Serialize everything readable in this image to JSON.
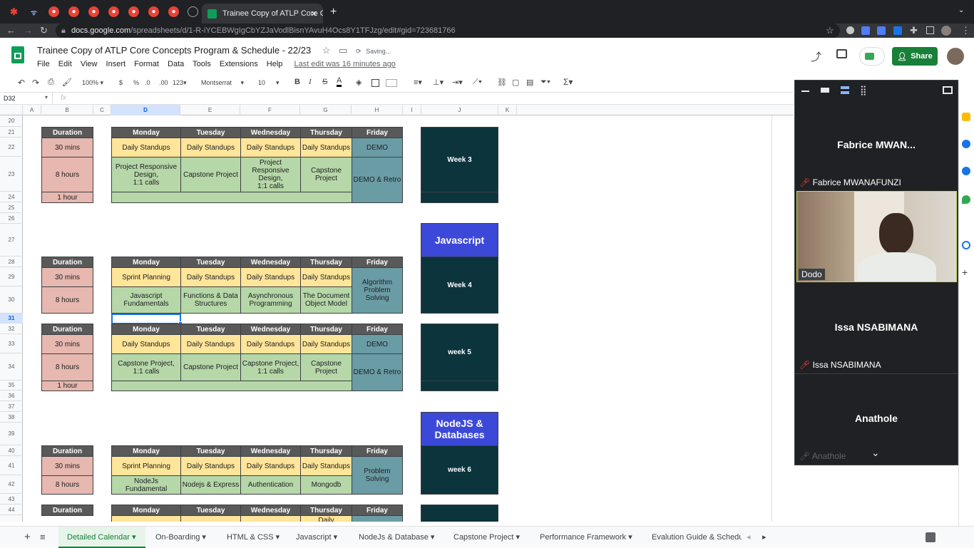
{
  "browser": {
    "active_tab_title": "Trainee Copy of ATLP Core Co",
    "url_host": "docs.google.com",
    "url_path": "/spreadsheets/d/1-R-iYCEBWgIgCbYZJaVodlBisnYAvuH4Ocs8Y1TFJzg/edit#gid=723681766"
  },
  "doc": {
    "title": "Trainee Copy of ATLP Core Concepts Program & Schedule - 22/23",
    "status": "Saving...",
    "menus": [
      "File",
      "Edit",
      "View",
      "Insert",
      "Format",
      "Data",
      "Tools",
      "Extensions",
      "Help"
    ],
    "last_edit": "Last edit was 16 minutes ago",
    "share_label": "Share"
  },
  "toolbar": {
    "zoom": "100%",
    "currency": "$",
    "percent": "%",
    "dec_dec": ".0",
    "dec_inc": ".00",
    "format_more": "123",
    "font": "Montserrat",
    "font_size": "10",
    "bold": "B",
    "italic": "I",
    "strike": "S",
    "text_color": "A"
  },
  "name_box": "D32",
  "fx": "fx",
  "columns": [
    "A",
    "B",
    "C",
    "D",
    "E",
    "F",
    "G",
    "H",
    "I",
    "J",
    "K"
  ],
  "rows": [
    "20",
    "21",
    "22",
    "23",
    "24",
    "25",
    "26",
    "27",
    "28",
    "29",
    "30",
    "31",
    "32",
    "33",
    "34",
    "35",
    "36",
    "37",
    "38",
    "39",
    "40",
    "41",
    "42",
    "43",
    "44",
    "45"
  ],
  "schedule": {
    "duration_header": "Duration",
    "days": [
      "Monday",
      "Tuesday",
      "Wednesday",
      "Thursday",
      "Friday"
    ],
    "d30": "30 mins",
    "d8": "8 hours",
    "d1": "1 hour",
    "w3": {
      "label": "Week 3",
      "mon1": "Daily Standups",
      "tue1": "Daily Standups",
      "wed1": "Daily Standups",
      "thu1": "Daily Standups",
      "fri1": "DEMO",
      "mon2": "Project Responsive Design,\n1:1 calls",
      "tue2": "Capstone Project",
      "wed2": "Project Responsive Design,\n1:1 calls",
      "thu2": "Capstone Project",
      "fri2": "DEMO & Retro"
    },
    "js": {
      "section": "Javascript",
      "label": "Week 4",
      "mon1": "Sprint Planning",
      "tue1": "Daily Standups",
      "wed1": "Daily Standups",
      "thu1": "Daily Standups",
      "fri": "Algorithm Problem Solving",
      "mon2": "Javascript Fundamentals",
      "tue2": "Functions & Data Structures",
      "wed2": "Asynchronous Programming",
      "thu2": "The Document Object Model"
    },
    "w5": {
      "label": "week 5",
      "mon1": "Daily Standups",
      "tue1": "Daily Standups",
      "wed1": "Daily Standups",
      "thu1": "Daily Standups",
      "fri1": "DEMO",
      "mon2": "Capstone Project,\n1:1 calls",
      "tue2": "Capstone Project",
      "wed2": "Capstone Project,\n1:1 calls",
      "thu2": "Capstone Project",
      "fri2": "DEMO & Retro"
    },
    "node": {
      "section": "NodeJS & Databases",
      "label": "week 6",
      "mon1": "Sprint Planning",
      "tue1": "Daily Standups",
      "wed1": "Daily Standups",
      "thu1": "Daily Standups",
      "fri": "Problem Solving",
      "mon2": "NodeJs Fundamental",
      "tue2": "Nodejs & Express",
      "wed2": "Authentication",
      "thu2": "Mongodb"
    },
    "last_thu": "Daily"
  },
  "sheet_tabs": [
    "Detailed Calendar",
    "On-Boarding",
    "HTML & CSS",
    "Javascript",
    "NodeJs & Database",
    "Capstone Project",
    "Performance Framework",
    "Evalution Guide & Schedu"
  ],
  "meet": {
    "p1_name": "Fabrice  MWAN...",
    "p1_label": "Fabrice MWANAFUNZI",
    "video_label": "Dodo",
    "p2_name": "Issa NSABIMANA",
    "p2_label": "Issa NSABIMANA",
    "p3_name": "Anathole",
    "p3_label": "Anathole"
  },
  "colors": {
    "share": "#188038",
    "header": "#595959",
    "pink": "#e6b8af",
    "yellow": "#ffe599",
    "green": "#b6d7a8",
    "teal": "#6a9ca5",
    "dark": "#0c343d",
    "blue": "#3c49d8"
  }
}
